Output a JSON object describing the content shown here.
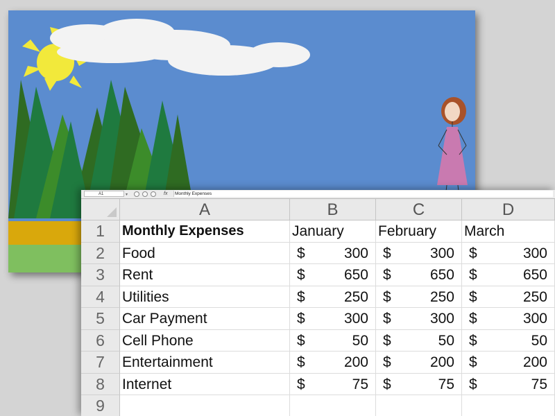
{
  "formula_bar": {
    "name_box": "A1",
    "fx_label": "fx",
    "content": "Monthly Expenses"
  },
  "columns": [
    "A",
    "B",
    "C",
    "D"
  ],
  "row_numbers": [
    "1",
    "2",
    "3",
    "4",
    "5",
    "6",
    "7",
    "8",
    "9"
  ],
  "table": {
    "title": "Monthly Expenses",
    "months": [
      "January",
      "February",
      "March"
    ],
    "currency": "$",
    "rows": [
      {
        "label": "Food",
        "values": [
          "300",
          "300",
          "300"
        ]
      },
      {
        "label": "Rent",
        "values": [
          "650",
          "650",
          "650"
        ]
      },
      {
        "label": "Utilities",
        "values": [
          "250",
          "250",
          "250"
        ]
      },
      {
        "label": "Car Payment",
        "values": [
          "300",
          "300",
          "300"
        ]
      },
      {
        "label": "Cell Phone",
        "values": [
          "50",
          "50",
          "50"
        ]
      },
      {
        "label": "Entertainment",
        "values": [
          "200",
          "200",
          "200"
        ]
      },
      {
        "label": "Internet",
        "values": [
          "75",
          "75",
          "75"
        ]
      }
    ]
  },
  "colors": {
    "sky": "#5b8ccf",
    "sun": "#f2e93b",
    "grass": "#7fbf5f",
    "path": "#d9a80c",
    "tree_dark": "#2f6b22",
    "tree_mid": "#1f7a3f",
    "tree_light": "#3c8c2a"
  },
  "icons": [
    "sun-icon",
    "cloud-icon",
    "tree-icon",
    "girl-figure-icon"
  ]
}
